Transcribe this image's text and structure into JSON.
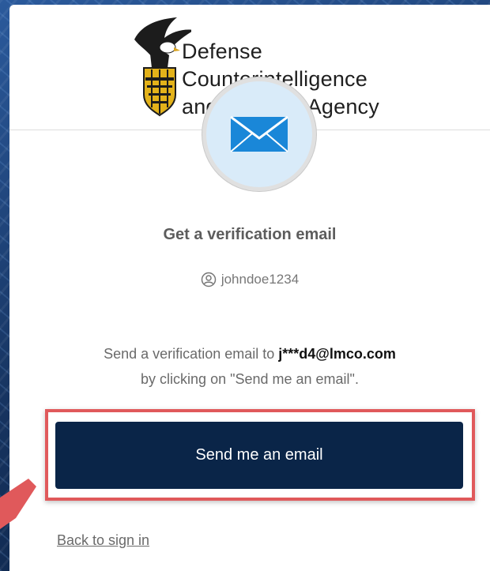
{
  "brand": {
    "org_name_line1": "Defense",
    "org_name_line2": "Counterintelligence",
    "org_name_line3": "and Security Agency"
  },
  "verification": {
    "title": "Get a verification email",
    "username": "johndoe1234",
    "instruction_prefix": "Send a verification email to ",
    "masked_email": "j***d4@lmco.com",
    "instruction_suffix": "by clicking on \"Send me an email\".",
    "send_button_label": "Send me an email",
    "back_link_label": "Back to sign in"
  },
  "icons": {
    "factor": "envelope-icon",
    "user": "user-circle-icon",
    "logo": "eagle-shield-icon",
    "pointer": "red-arrow-icon"
  },
  "colors": {
    "button_bg": "#0a2548",
    "highlight": "#e0595b",
    "icon_circle": "#d9ebf9",
    "envelope": "#1a87d8"
  }
}
